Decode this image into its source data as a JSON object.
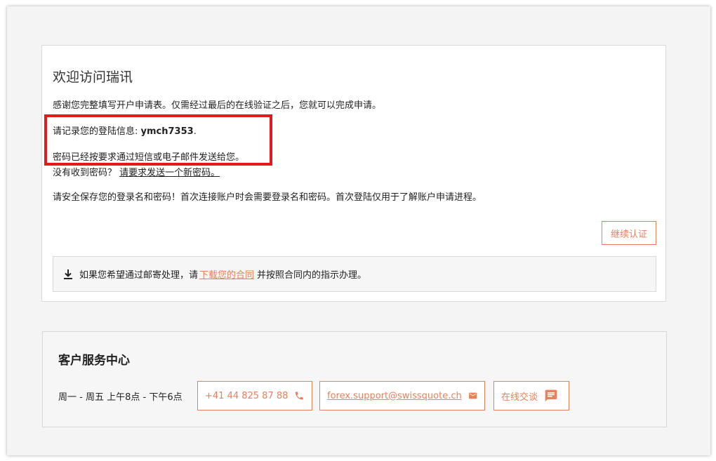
{
  "welcome": {
    "title": "欢迎访问瑞讯",
    "intro": "感谢您完整填写开户申请表。仅需经过最后的在线验证之后，您就可以完成申请。",
    "login_prefix": "请记录您的登陆信息: ",
    "username": "ymch7353",
    "login_suffix": ".",
    "password_sent": "密码已经按要求通过短信或电子邮件发送给您。",
    "no_password_prefix": "没有收到密码？ ",
    "resend_link": "请要求发送一个新密码。",
    "safety_note": "请安全保存您的登录名和密码！首次连接账户时会需要登录名和密码。首次登陆仅用于了解账户申请进程。",
    "continue_button": "继续认证",
    "mail_prefix": "如果您希望通过邮寄处理，请",
    "mail_link": "下载您的合同",
    "mail_suffix": "并按照合同内的指示办理。"
  },
  "service": {
    "title": "客户服务中心",
    "hours": "周一 - 周五 上午8点 - 下午6点",
    "phone": "+41 44 825 87 88",
    "email": "forex.support@swissquote.ch",
    "chat": "在线交谈"
  },
  "icons": {
    "download": "download-icon",
    "phone": "phone-icon",
    "email": "mail-icon",
    "chat": "chat-icon"
  },
  "colors": {
    "accent": "#e9805a",
    "highlight": "#e11b1b"
  }
}
